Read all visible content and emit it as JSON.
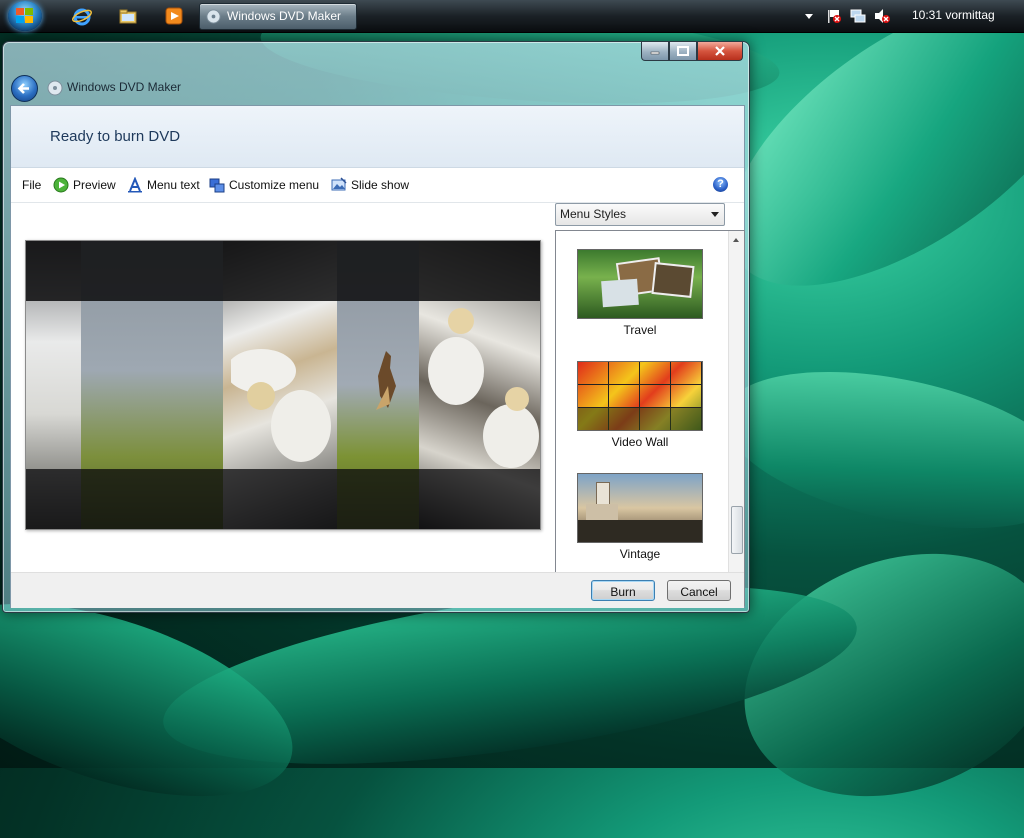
{
  "taskbar": {
    "active_task": "Windows DVD Maker",
    "clock": "10:31 vormittag",
    "quick_launch": [
      "internet-explorer-icon",
      "explorer-icon",
      "media-player-icon"
    ]
  },
  "window": {
    "title": "Windows DVD Maker",
    "header_title": "Ready to burn DVD",
    "toolbar": {
      "file": "File",
      "preview": "Preview",
      "menu_text": "Menu text",
      "customize_menu": "Customize menu",
      "slide_show": "Slide show"
    },
    "menu_styles_select": "Menu Styles",
    "styles": [
      {
        "label": "Travel"
      },
      {
        "label": "Video Wall"
      },
      {
        "label": "Vintage"
      }
    ],
    "buttons": {
      "burn": "Burn",
      "cancel": "Cancel"
    }
  },
  "colors": {
    "desktop_accent": "#139a78",
    "header_text": "#1e395b",
    "default_button_border": "#3c7fb1"
  }
}
